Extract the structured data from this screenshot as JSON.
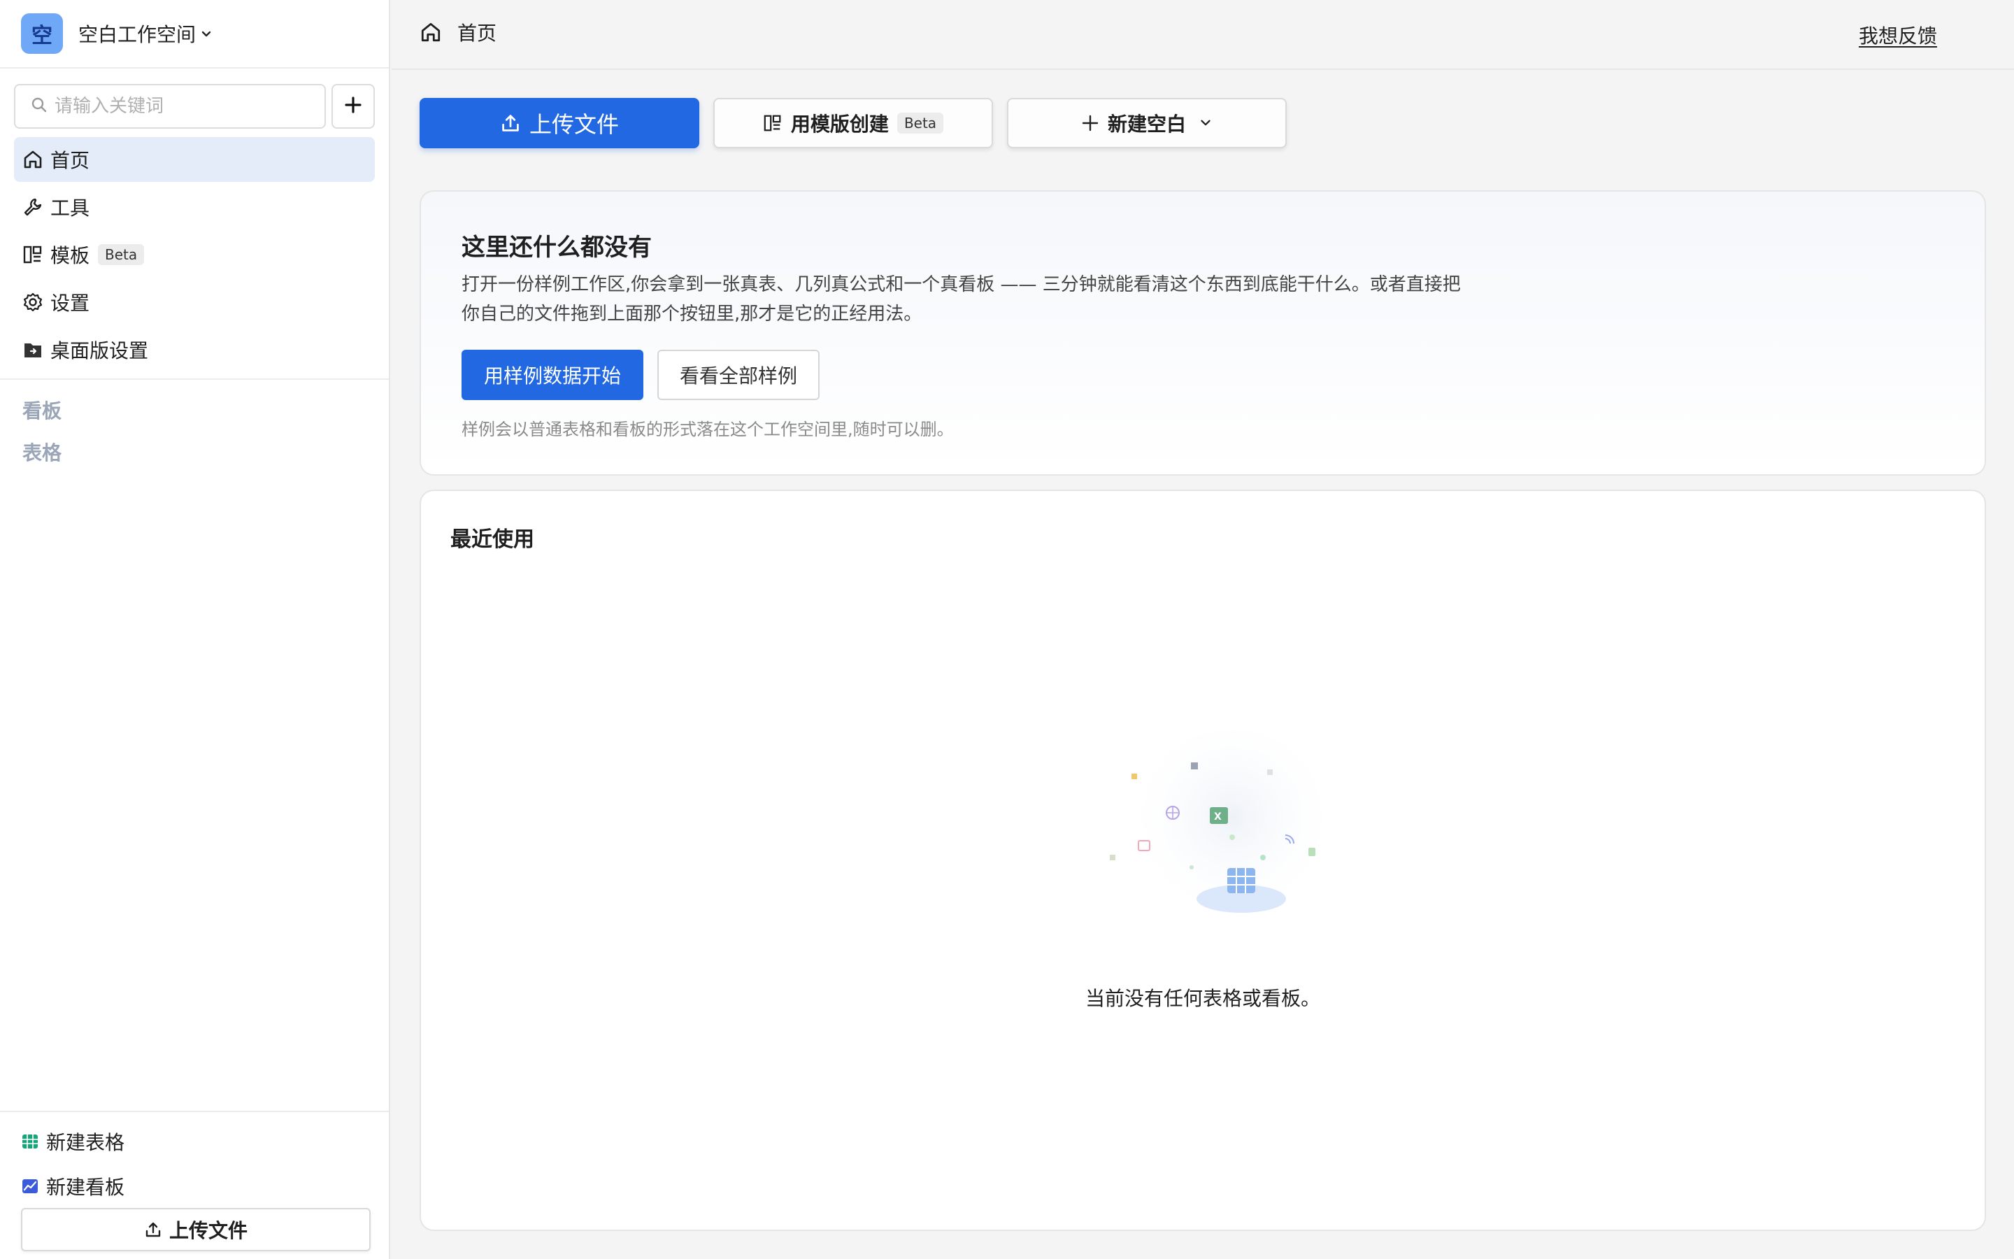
{
  "workspace": {
    "avatar_char": "空",
    "name": "空白工作空间"
  },
  "search": {
    "placeholder": "请输入关键词"
  },
  "nav": {
    "items": [
      {
        "label": "首页",
        "icon": "home-icon",
        "active": true
      },
      {
        "label": "工具",
        "icon": "wrench-icon"
      },
      {
        "label": "模板",
        "icon": "template-icon",
        "badge": "Beta"
      },
      {
        "label": "设置",
        "icon": "gear-icon"
      },
      {
        "label": "桌面版设置",
        "icon": "desktop-folder-icon"
      }
    ]
  },
  "sections": {
    "boards": "看板",
    "tables": "表格"
  },
  "sidebar_bottom": {
    "new_table": "新建表格",
    "new_board": "新建看板",
    "upload": "上传文件"
  },
  "topbar": {
    "breadcrumb": "首页",
    "feedback": "我想反馈"
  },
  "actions": {
    "upload": "上传文件",
    "template": "用模版创建",
    "template_badge": "Beta",
    "new_blank": "新建空白"
  },
  "hero": {
    "title": "这里还什么都没有",
    "desc": "打开一份样例工作区,你会拿到一张真表、几列真公式和一个真看板 —— 三分钟就能看清这个东西到底能干什么。或者直接把你自己的文件拖到上面那个按钮里,那才是它的正经用法。",
    "primary": "用样例数据开始",
    "secondary": "看看全部样例",
    "note": "样例会以普通表格和看板的形式落在这个工作空间里,随时可以删。"
  },
  "recent": {
    "title": "最近使用",
    "empty": "当前没有任何表格或看板。"
  },
  "colors": {
    "accent": "#2268e2",
    "active_nav_bg": "#e3ecf8",
    "muted_section": "#9aa6b8"
  }
}
